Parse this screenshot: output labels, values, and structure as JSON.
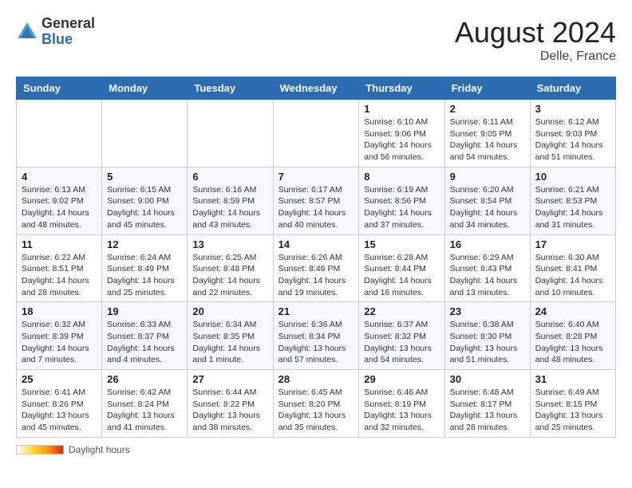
{
  "header": {
    "logo_general": "General",
    "logo_blue": "Blue",
    "month_title": "August 2024",
    "location": "Delle, France"
  },
  "days_of_week": [
    "Sunday",
    "Monday",
    "Tuesday",
    "Wednesday",
    "Thursday",
    "Friday",
    "Saturday"
  ],
  "weeks": [
    [
      {
        "day": "",
        "detail": ""
      },
      {
        "day": "",
        "detail": ""
      },
      {
        "day": "",
        "detail": ""
      },
      {
        "day": "",
        "detail": ""
      },
      {
        "day": "1",
        "detail": "Sunrise: 6:10 AM\nSunset: 9:06 PM\nDaylight: 14 hours and 56 minutes."
      },
      {
        "day": "2",
        "detail": "Sunrise: 6:11 AM\nSunset: 9:05 PM\nDaylight: 14 hours and 54 minutes."
      },
      {
        "day": "3",
        "detail": "Sunrise: 6:12 AM\nSunset: 9:03 PM\nDaylight: 14 hours and 51 minutes."
      }
    ],
    [
      {
        "day": "4",
        "detail": "Sunrise: 6:13 AM\nSunset: 9:02 PM\nDaylight: 14 hours and 48 minutes."
      },
      {
        "day": "5",
        "detail": "Sunrise: 6:15 AM\nSunset: 9:00 PM\nDaylight: 14 hours and 45 minutes."
      },
      {
        "day": "6",
        "detail": "Sunrise: 6:16 AM\nSunset: 8:59 PM\nDaylight: 14 hours and 43 minutes."
      },
      {
        "day": "7",
        "detail": "Sunrise: 6:17 AM\nSunset: 8:57 PM\nDaylight: 14 hours and 40 minutes."
      },
      {
        "day": "8",
        "detail": "Sunrise: 6:19 AM\nSunset: 8:56 PM\nDaylight: 14 hours and 37 minutes."
      },
      {
        "day": "9",
        "detail": "Sunrise: 6:20 AM\nSunset: 8:54 PM\nDaylight: 14 hours and 34 minutes."
      },
      {
        "day": "10",
        "detail": "Sunrise: 6:21 AM\nSunset: 8:53 PM\nDaylight: 14 hours and 31 minutes."
      }
    ],
    [
      {
        "day": "11",
        "detail": "Sunrise: 6:22 AM\nSunset: 8:51 PM\nDaylight: 14 hours and 28 minutes."
      },
      {
        "day": "12",
        "detail": "Sunrise: 6:24 AM\nSunset: 8:49 PM\nDaylight: 14 hours and 25 minutes."
      },
      {
        "day": "13",
        "detail": "Sunrise: 6:25 AM\nSunset: 8:48 PM\nDaylight: 14 hours and 22 minutes."
      },
      {
        "day": "14",
        "detail": "Sunrise: 6:26 AM\nSunset: 8:46 PM\nDaylight: 14 hours and 19 minutes."
      },
      {
        "day": "15",
        "detail": "Sunrise: 6:28 AM\nSunset: 8:44 PM\nDaylight: 14 hours and 16 minutes."
      },
      {
        "day": "16",
        "detail": "Sunrise: 6:29 AM\nSunset: 8:43 PM\nDaylight: 14 hours and 13 minutes."
      },
      {
        "day": "17",
        "detail": "Sunrise: 6:30 AM\nSunset: 8:41 PM\nDaylight: 14 hours and 10 minutes."
      }
    ],
    [
      {
        "day": "18",
        "detail": "Sunrise: 6:32 AM\nSunset: 8:39 PM\nDaylight: 14 hours and 7 minutes."
      },
      {
        "day": "19",
        "detail": "Sunrise: 6:33 AM\nSunset: 8:37 PM\nDaylight: 14 hours and 4 minutes."
      },
      {
        "day": "20",
        "detail": "Sunrise: 6:34 AM\nSunset: 8:35 PM\nDaylight: 14 hours and 1 minute."
      },
      {
        "day": "21",
        "detail": "Sunrise: 6:36 AM\nSunset: 8:34 PM\nDaylight: 13 hours and 57 minutes."
      },
      {
        "day": "22",
        "detail": "Sunrise: 6:37 AM\nSunset: 8:32 PM\nDaylight: 13 hours and 54 minutes."
      },
      {
        "day": "23",
        "detail": "Sunrise: 6:38 AM\nSunset: 8:30 PM\nDaylight: 13 hours and 51 minutes."
      },
      {
        "day": "24",
        "detail": "Sunrise: 6:40 AM\nSunset: 8:28 PM\nDaylight: 13 hours and 48 minutes."
      }
    ],
    [
      {
        "day": "25",
        "detail": "Sunrise: 6:41 AM\nSunset: 8:26 PM\nDaylight: 13 hours and 45 minutes."
      },
      {
        "day": "26",
        "detail": "Sunrise: 6:42 AM\nSunset: 8:24 PM\nDaylight: 13 hours and 41 minutes."
      },
      {
        "day": "27",
        "detail": "Sunrise: 6:44 AM\nSunset: 8:22 PM\nDaylight: 13 hours and 38 minutes."
      },
      {
        "day": "28",
        "detail": "Sunrise: 6:45 AM\nSunset: 8:20 PM\nDaylight: 13 hours and 35 minutes."
      },
      {
        "day": "29",
        "detail": "Sunrise: 6:46 AM\nSunset: 8:19 PM\nDaylight: 13 hours and 32 minutes."
      },
      {
        "day": "30",
        "detail": "Sunrise: 6:48 AM\nSunset: 8:17 PM\nDaylight: 13 hours and 28 minutes."
      },
      {
        "day": "31",
        "detail": "Sunrise: 6:49 AM\nSunset: 8:15 PM\nDaylight: 13 hours and 25 minutes."
      }
    ]
  ],
  "footer": {
    "label": "Daylight hours"
  }
}
